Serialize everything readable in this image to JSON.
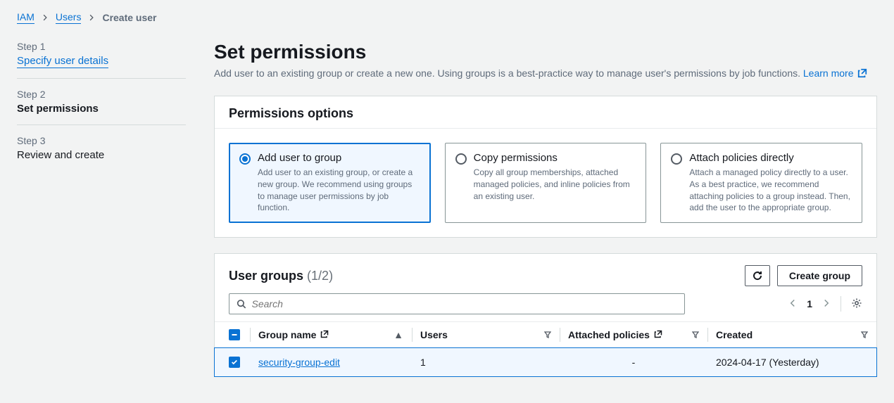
{
  "breadcrumb": {
    "root": "IAM",
    "users": "Users",
    "current": "Create user"
  },
  "steps": [
    {
      "label": "Step 1",
      "title": "Specify user details"
    },
    {
      "label": "Step 2",
      "title": "Set permissions"
    },
    {
      "label": "Step 3",
      "title": "Review and create"
    }
  ],
  "header": {
    "title": "Set permissions",
    "subtitle": "Add user to an existing group or create a new one. Using groups is a best-practice way to manage user's permissions by job functions. ",
    "learn_more": "Learn more"
  },
  "permissions_panel": {
    "title": "Permissions options",
    "options": [
      {
        "title": "Add user to group",
        "desc": "Add user to an existing group, or create a new group. We recommend using groups to manage user permissions by job function."
      },
      {
        "title": "Copy permissions",
        "desc": "Copy all group memberships, attached managed policies, and inline policies from an existing user."
      },
      {
        "title": "Attach policies directly",
        "desc": "Attach a managed policy directly to a user. As a best practice, we recommend attaching policies to a group instead. Then, add the user to the appropriate group."
      }
    ]
  },
  "groups_panel": {
    "title": "User groups",
    "count": "(1/2)",
    "refresh_label": "Refresh",
    "create_label": "Create group",
    "search_placeholder": "Search",
    "page": "1",
    "columns": {
      "group_name": "Group name",
      "users": "Users",
      "attached": "Attached policies",
      "created": "Created"
    },
    "rows": [
      {
        "name": "security-group-edit",
        "users": "1",
        "policies": "-",
        "created": "2024-04-17 (Yesterday)"
      }
    ]
  }
}
